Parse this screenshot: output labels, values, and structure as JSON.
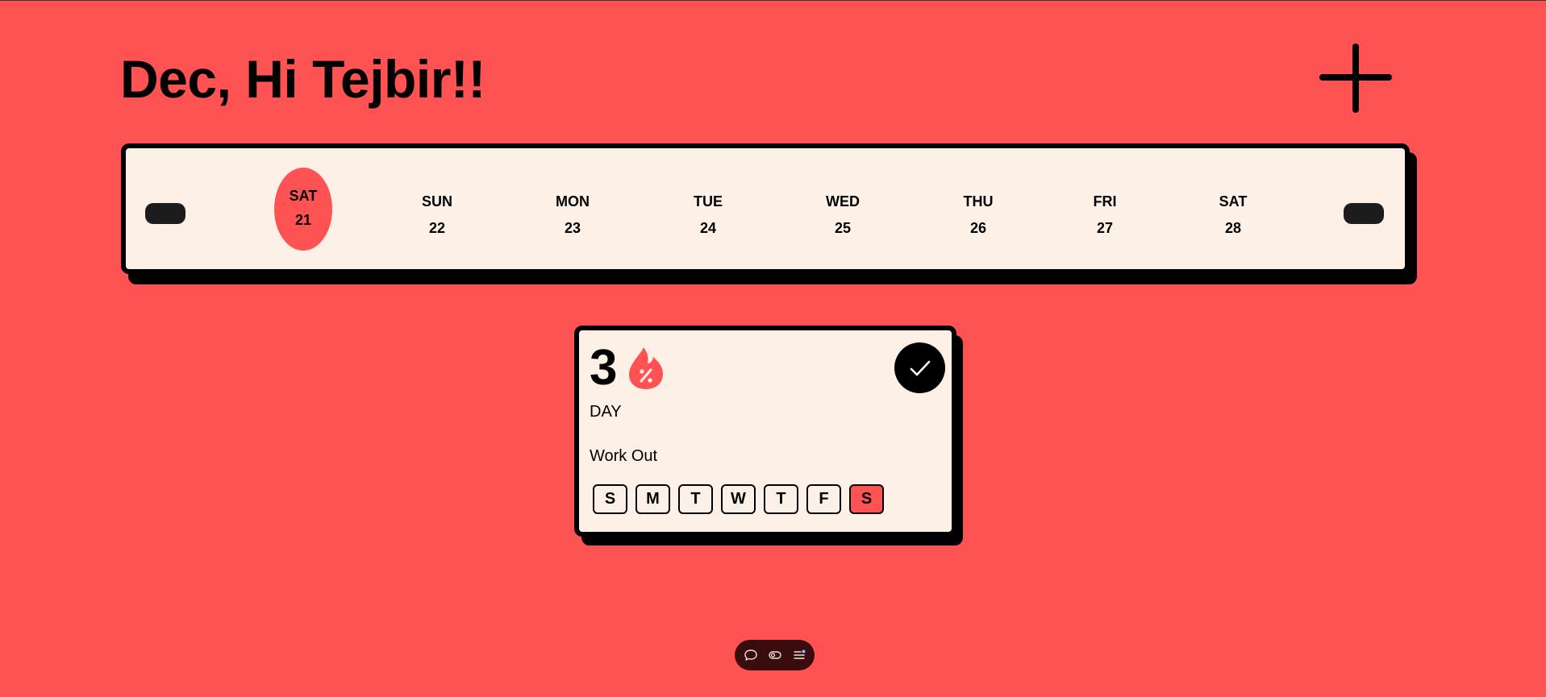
{
  "header": {
    "greeting": "Dec, Hi Tejbir!!",
    "add_icon": "plus-icon"
  },
  "calendar": {
    "prev_icon": "pill-prev",
    "next_icon": "pill-next",
    "selected_color": "#ff5252",
    "days": [
      {
        "name": "SAT",
        "date": "21",
        "selected": true
      },
      {
        "name": "SUN",
        "date": "22"
      },
      {
        "name": "MON",
        "date": "23"
      },
      {
        "name": "TUE",
        "date": "24"
      },
      {
        "name": "WED",
        "date": "25"
      },
      {
        "name": "THU",
        "date": "26"
      },
      {
        "name": "FRI",
        "date": "27"
      },
      {
        "name": "SAT",
        "date": "28"
      }
    ]
  },
  "habit": {
    "streak": "3",
    "streak_unit": "DAY",
    "name": "Work Out",
    "streak_icon": "flame-percent-icon",
    "done_icon": "check-icon",
    "weekdays": [
      {
        "label": "S",
        "active": false
      },
      {
        "label": "M",
        "active": false
      },
      {
        "label": "T",
        "active": false
      },
      {
        "label": "W",
        "active": false
      },
      {
        "label": "T",
        "active": false
      },
      {
        "label": "F",
        "active": false
      },
      {
        "label": "S",
        "active": true
      }
    ]
  },
  "toolbar": {
    "icons": [
      "comment-icon",
      "toggle-icon",
      "list-icon"
    ]
  },
  "colors": {
    "background": "#ff5252",
    "card": "#fdf1e7",
    "accent": "#ff5252",
    "ink": "#000000"
  }
}
